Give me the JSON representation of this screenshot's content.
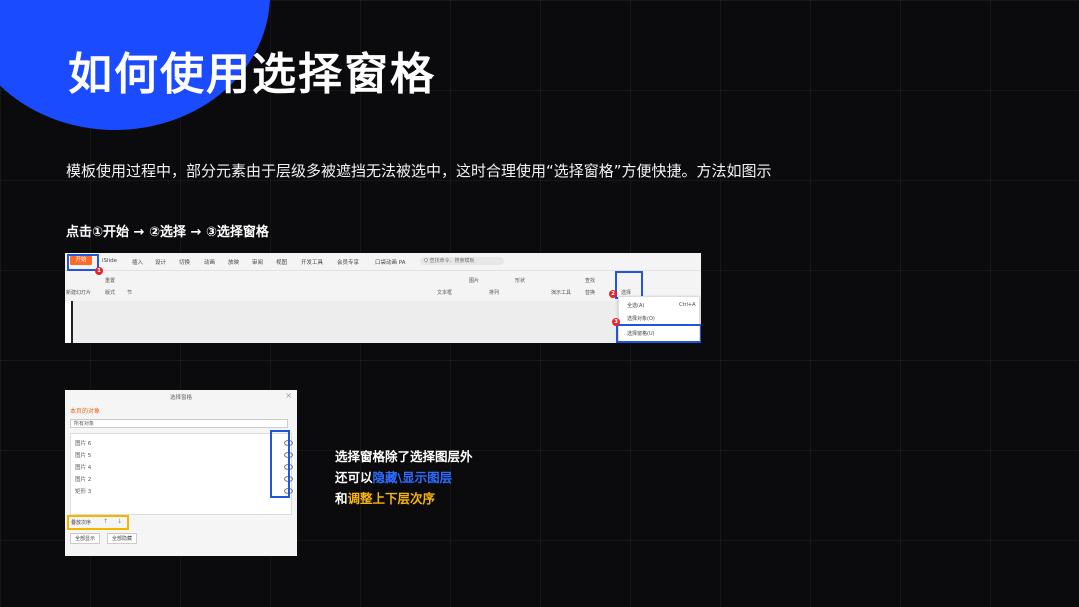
{
  "title": "如何使用选择窗格",
  "description": "模板使用过程中，部分元素由于层级多被遮挡无法被选中，这时合理使用“选择窗格”方便快捷。方法如图示",
  "steps": "点击①开始 → ②选择 → ③选择窗格",
  "ribbon": {
    "start_tab": "开始",
    "tabs": [
      "iSlide",
      "插入",
      "设计",
      "切换",
      "动画",
      "放映",
      "审阅",
      "视图",
      "开发工具",
      "会员专享",
      "口袋动画 PA"
    ],
    "search_placeholder": "Q 查找命令、搜索模板",
    "tools_row1": [
      "重置",
      "图片",
      "形状",
      "查找"
    ],
    "tools_row2": [
      "新建幻灯片",
      "版式",
      "节",
      "文本框",
      "排列",
      "演示工具",
      "替换",
      "选择"
    ],
    "menu": {
      "select_all": "全选(A)",
      "select_all_shortcut": "Ctrl+A",
      "select_objects": "选择对象(O)",
      "selection_pane": "选择窗格(U)"
    },
    "markers": [
      "1",
      "2",
      "3"
    ]
  },
  "pane": {
    "title": "选择窗格",
    "subtitle": "本页的对象",
    "dropdown": "所有对象",
    "items": [
      "图片 6",
      "图片 5",
      "图片 4",
      "图片 2",
      "矩形 3"
    ],
    "order_label": "叠放次序",
    "show_all": "全部显示",
    "hide_all": "全部隐藏"
  },
  "side_text": {
    "line1": "选择窗格除了选择图层外",
    "line2_prefix": "还可以",
    "line2_highlight": "隐藏\\显示图层",
    "line3_prefix": "和",
    "line3_highlight": "调整上下层次序"
  },
  "colors": {
    "background": "#0b0b0d",
    "accent_blue": "#1a4bff",
    "highlight_blue": "#2d6bff",
    "highlight_yellow": "#f6b40e",
    "marker_red": "#e5252a"
  }
}
